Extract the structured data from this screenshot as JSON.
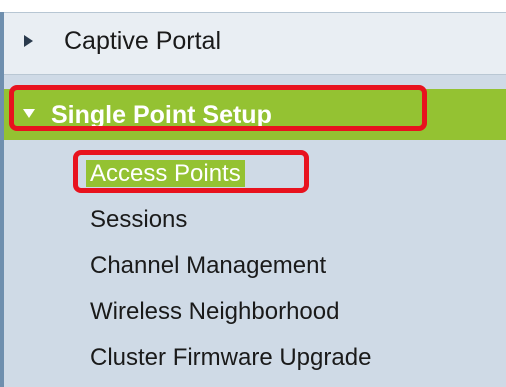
{
  "nav": {
    "captive_portal": {
      "label": "Captive Portal",
      "icon": "triangle-right-icon",
      "expanded": false
    },
    "single_point_setup": {
      "label": "Single Point Setup",
      "icon": "triangle-down-icon",
      "expanded": true,
      "items": [
        {
          "label": "Access Points",
          "selected": true
        },
        {
          "label": "Sessions"
        },
        {
          "label": "Channel Management"
        },
        {
          "label": "Wireless Neighborhood"
        },
        {
          "label": "Cluster Firmware Upgrade"
        }
      ]
    }
  },
  "colors": {
    "selected_green": "#94c232",
    "highlight_red": "#e8121e",
    "panel_blue": "#cfdae6"
  }
}
